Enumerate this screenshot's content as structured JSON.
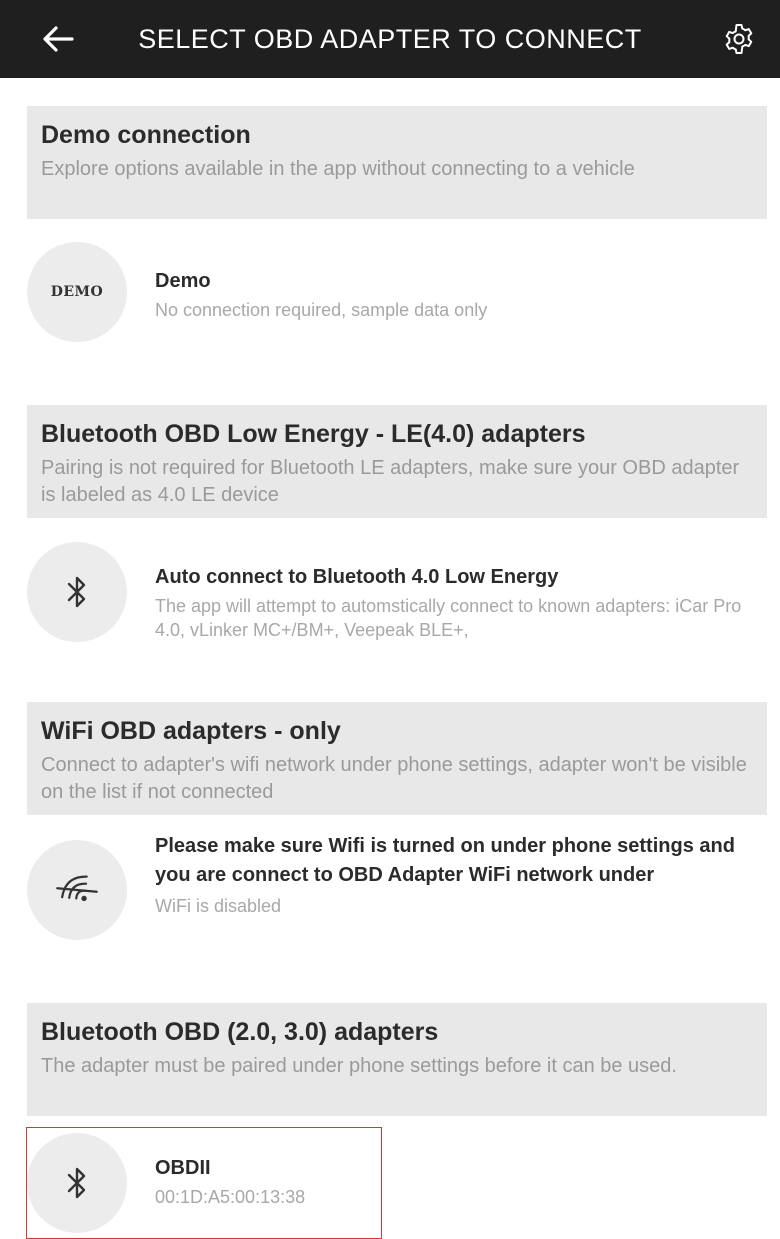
{
  "appbar": {
    "title": "SELECT OBD ADAPTER TO CONNECT",
    "back_icon": "arrow-left-icon",
    "settings_icon": "gear-icon"
  },
  "sections": {
    "demo": {
      "title": "Demo connection",
      "description": "Explore options available in the app without connecting to a vehicle",
      "item": {
        "avatar_text": "DEMO",
        "title": "Demo",
        "subtitle": "No connection required, sample data only"
      }
    },
    "ble": {
      "title": "Bluetooth OBD Low Energy - LE(4.0) adapters",
      "description": "Pairing is not required for Bluetooth LE adapters, make sure your OBD adapter is labeled as 4.0 LE device",
      "item": {
        "icon": "bluetooth-icon",
        "title": "Auto connect to Bluetooth 4.0 Low Energy",
        "subtitle": "The app will attempt to automstically connect to known adapters: iCar Pro 4.0, vLinker MC+/BM+, Veepeak BLE+,"
      }
    },
    "wifi": {
      "title": "WiFi OBD adapters - only",
      "description": "Connect to adapter's wifi network under phone settings, adapter won't be visible on the list if not connected",
      "item": {
        "icon": "wifi-off-icon",
        "title": "Please make sure Wifi is turned on under phone settings and you are connect to OBD Adapter WiFi network under",
        "subtitle": "WiFi is disabled"
      }
    },
    "classic": {
      "title": "Bluetooth OBD (2.0, 3.0) adapters",
      "description": "The adapter must be paired under phone settings before it can be used.",
      "item": {
        "icon": "bluetooth-icon",
        "title": "OBDII",
        "subtitle": "00:1D:A5:00:13:38"
      }
    }
  },
  "colors": {
    "appbar_bg": "#1f1f1f",
    "section_bg": "#e8e8e8",
    "avatar_bg": "#ececec",
    "highlight_border": "#d23a3a"
  }
}
